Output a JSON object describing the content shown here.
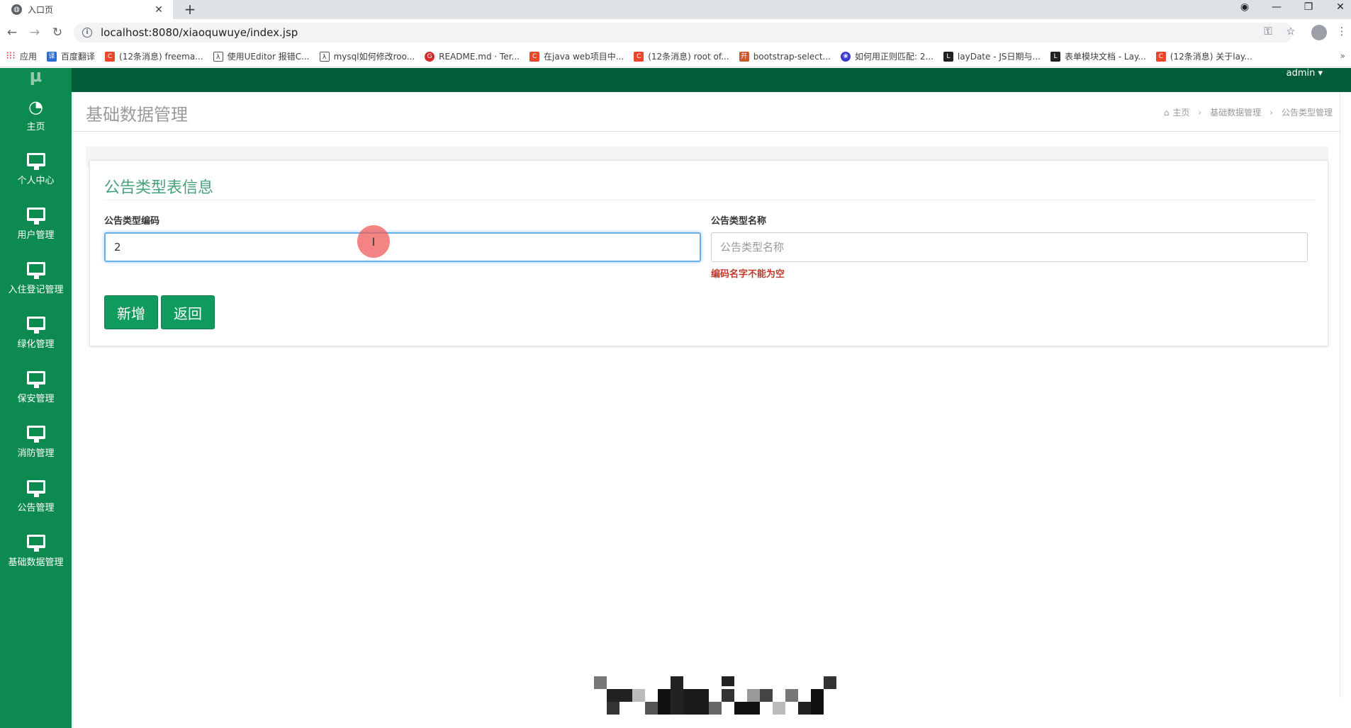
{
  "browser": {
    "tab_title": "入口页",
    "tab_close": "✕",
    "new_tab": "+",
    "url": "localhost:8080/xiaoquwuye/index.jsp",
    "bookmarks": [
      {
        "label": "应用",
        "icon": "apps-grid-icon"
      },
      {
        "label": "百度翻译",
        "icon": "baidu-translate-icon"
      },
      {
        "label": "(12条消息) freema...",
        "icon": "csdn-icon"
      },
      {
        "label": "使用UEditor 报错C...",
        "icon": "lambda-icon"
      },
      {
        "label": "mysql如何修改roo...",
        "icon": "lambda-icon"
      },
      {
        "label": "README.md · Ter...",
        "icon": "gitee-icon"
      },
      {
        "label": "在java web项目中...",
        "icon": "csdn-icon"
      },
      {
        "label": "(12条消息) root of...",
        "icon": "csdn-icon"
      },
      {
        "label": "bootstrap-select...",
        "icon": "oschina-icon"
      },
      {
        "label": "如何用正则匹配: 2...",
        "icon": "baidu-paw-icon"
      },
      {
        "label": "layDate - JS日期与...",
        "icon": "layui-icon"
      },
      {
        "label": "表单模块文档 - Lay...",
        "icon": "layui-icon"
      },
      {
        "label": "(12条消息) 关于lay...",
        "icon": "csdn-icon"
      }
    ],
    "bookmarks_more": "»"
  },
  "sidebar": {
    "logo": "μ",
    "items": [
      {
        "label": "主页",
        "icon": "dashboard-icon"
      },
      {
        "label": "个人中心",
        "icon": "monitor-icon"
      },
      {
        "label": "用户管理",
        "icon": "monitor-icon"
      },
      {
        "label": "入住登记管理",
        "icon": "monitor-icon"
      },
      {
        "label": "绿化管理",
        "icon": "monitor-icon"
      },
      {
        "label": "保安管理",
        "icon": "monitor-icon"
      },
      {
        "label": "消防管理",
        "icon": "monitor-icon"
      },
      {
        "label": "公告管理",
        "icon": "monitor-icon"
      },
      {
        "label": "基础数据管理",
        "icon": "monitor-icon"
      }
    ]
  },
  "topbar": {
    "user": "admin ▾"
  },
  "header": {
    "title": "基础数据管理",
    "breadcrumb": [
      "主页",
      "基础数据管理",
      "公告类型管理"
    ],
    "breadcrumb_sep": "›"
  },
  "form": {
    "title": "公告类型表信息",
    "code_label": "公告类型编码",
    "code_value": "2",
    "name_label": "公告类型名称",
    "name_placeholder": "公告类型名称",
    "name_value": "",
    "error": "编码名字不能为空",
    "add_button": "新增",
    "back_button": "返回"
  },
  "colors": {
    "sidebar": "#0d8a4f",
    "topbar": "#035c3a",
    "accent_title": "#47a27a",
    "button": "#0f9b5d",
    "error": "#c0392b",
    "focus_border": "#66afe9"
  }
}
